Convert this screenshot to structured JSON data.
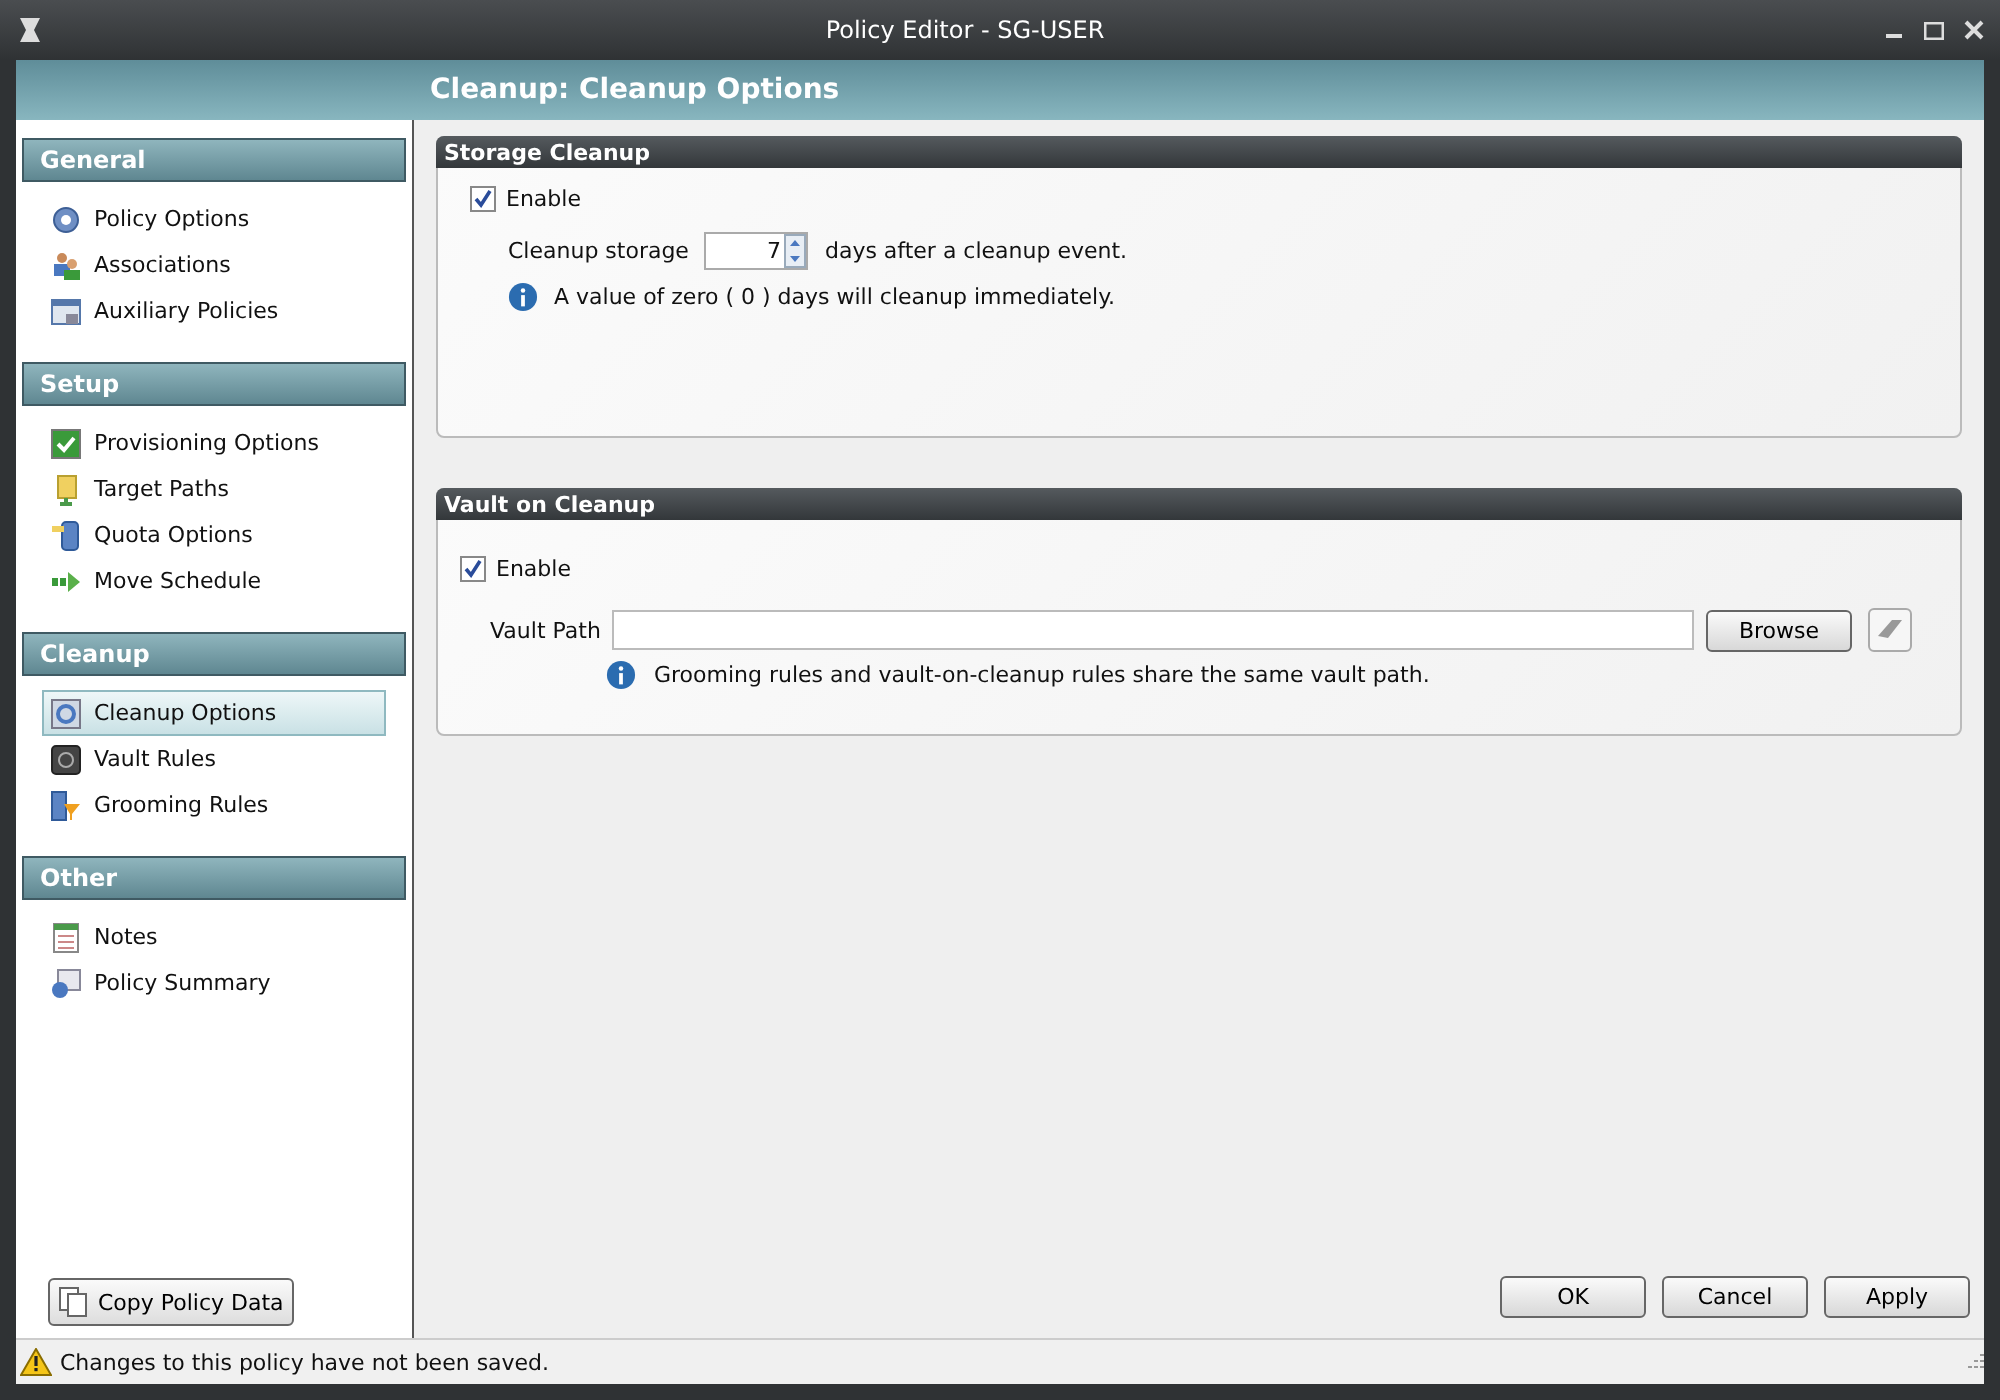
{
  "window": {
    "title": "Policy Editor - SG-USER"
  },
  "page_title": "Cleanup: Cleanup Options",
  "sidebar": {
    "groups": [
      {
        "title": "General",
        "items": [
          {
            "label": "Policy Options",
            "selected": false
          },
          {
            "label": "Associations",
            "selected": false
          },
          {
            "label": "Auxiliary Policies",
            "selected": false
          }
        ]
      },
      {
        "title": "Setup",
        "items": [
          {
            "label": "Provisioning Options",
            "selected": false
          },
          {
            "label": "Target Paths",
            "selected": false
          },
          {
            "label": "Quota Options",
            "selected": false
          },
          {
            "label": "Move Schedule",
            "selected": false
          }
        ]
      },
      {
        "title": "Cleanup",
        "items": [
          {
            "label": "Cleanup Options",
            "selected": true
          },
          {
            "label": "Vault Rules",
            "selected": false
          },
          {
            "label": "Grooming Rules",
            "selected": false
          }
        ]
      },
      {
        "title": "Other",
        "items": [
          {
            "label": "Notes",
            "selected": false
          },
          {
            "label": "Policy Summary",
            "selected": false
          }
        ]
      }
    ],
    "copy_button": "Copy Policy Data"
  },
  "storage_cleanup": {
    "title": "Storage Cleanup",
    "enable": {
      "label": "Enable",
      "checked": true
    },
    "label": "Cleanup storage",
    "days": "7",
    "suffix": "days after a cleanup event.",
    "info": "A value of zero ( 0 ) days will cleanup immediately."
  },
  "vault_on_cleanup": {
    "title": "Vault on Cleanup",
    "enable": {
      "label": "Enable",
      "checked": true
    },
    "path_label": "Vault Path",
    "browse_button": "Browse",
    "info": "Grooming rules and vault-on-cleanup rules share the same vault path."
  },
  "buttons": [
    "OK",
    "Cancel",
    "Apply"
  ],
  "status_bar": "Changes to this policy have not been saved."
}
